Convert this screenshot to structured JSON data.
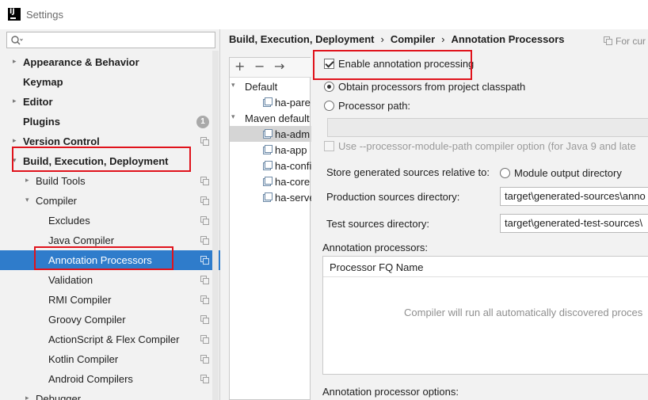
{
  "window": {
    "title": "Settings"
  },
  "search": {
    "placeholder": "",
    "value": ""
  },
  "sidebar": {
    "items": [
      {
        "label": "Appearance & Behavior",
        "expanded": false
      },
      {
        "label": "Keymap"
      },
      {
        "label": "Editor",
        "expanded": false
      },
      {
        "label": "Plugins",
        "badge": "1"
      },
      {
        "label": "Version Control",
        "expanded": false
      },
      {
        "label": "Build, Execution, Deployment",
        "expanded": true
      },
      {
        "label": "Build Tools",
        "expanded": false
      },
      {
        "label": "Compiler",
        "expanded": true
      },
      {
        "label": "Excludes"
      },
      {
        "label": "Java Compiler"
      },
      {
        "label": "Annotation Processors",
        "selected": true
      },
      {
        "label": "Validation"
      },
      {
        "label": "RMI Compiler"
      },
      {
        "label": "Groovy Compiler"
      },
      {
        "label": "ActionScript & Flex Compiler"
      },
      {
        "label": "Kotlin Compiler"
      },
      {
        "label": "Android Compilers"
      },
      {
        "label": "Debugger",
        "expanded": false
      }
    ]
  },
  "breadcrumb": [
    "Build, Execution, Deployment",
    "Compiler",
    "Annotation Processors"
  ],
  "scope_hint": "For cur",
  "profiles": {
    "toolbar": [
      "+",
      "−",
      "→"
    ],
    "items": [
      {
        "label": "Default",
        "group": true
      },
      {
        "label": "ha-pare"
      },
      {
        "label": "Maven default",
        "group": true
      },
      {
        "label": "ha-adm",
        "selected": true
      },
      {
        "label": "ha-app"
      },
      {
        "label": "ha-confi"
      },
      {
        "label": "ha-core"
      },
      {
        "label": "ha-serve"
      }
    ]
  },
  "settings": {
    "enable_annotation": {
      "label": "Enable annotation processing",
      "checked": true
    },
    "obtain_classpath": {
      "label": "Obtain processors from project classpath",
      "checked": true
    },
    "processor_path": {
      "label": "Processor path:",
      "checked": false
    },
    "module_path": {
      "label": "Use --processor-module-path compiler option (for Java 9 and late"
    },
    "store_generated": {
      "label": "Store generated sources relative to:",
      "option": "Module output directory"
    },
    "production_dir": {
      "label": "Production sources directory:",
      "value": "target\\generated-sources\\anno"
    },
    "test_dir": {
      "label": "Test sources directory:",
      "value": "target\\generated-test-sources\\"
    },
    "annotation_processors": {
      "label": "Annotation processors:",
      "column": "Processor FQ Name",
      "empty": "Compiler will run all automatically discovered proces"
    },
    "annotation_options": {
      "label": "Annotation processor options:"
    }
  },
  "colors": {
    "selection": "#2f7ccb",
    "highlight_box": "#e0131c"
  }
}
